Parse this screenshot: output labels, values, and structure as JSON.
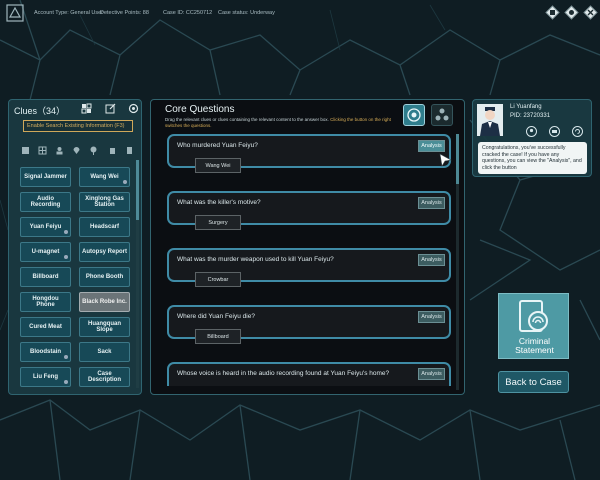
{
  "topbar": {
    "account": "Account Type: General User",
    "points": "Detective Points: 88",
    "case_id": "Case ID: CC250712",
    "status": "Case status: Underway"
  },
  "clues": {
    "title": "Clues（34）",
    "search_placeholder": "Enable Search Existing Information (F3)",
    "items": [
      {
        "label": "Signal Jammer"
      },
      {
        "label": "Wang Wei"
      },
      {
        "label": "Audio Recording"
      },
      {
        "label": "Xinglong Gas Station"
      },
      {
        "label": "Yuan Feiyu"
      },
      {
        "label": "Headscarf"
      },
      {
        "label": "U-magnet"
      },
      {
        "label": "Autopsy Report"
      },
      {
        "label": "Billboard"
      },
      {
        "label": "Phone Booth"
      },
      {
        "label": "Hongdou Phone"
      },
      {
        "label": "Black Robe Inc."
      },
      {
        "label": "Cured Meat"
      },
      {
        "label": "Huangquan Slope"
      },
      {
        "label": "Bloodstain"
      },
      {
        "label": "Sack"
      },
      {
        "label": "Liu Feng"
      },
      {
        "label": "Case Description"
      }
    ]
  },
  "core": {
    "title": "Core Questions",
    "instruction_a": "Drag the relevant clues or clues containing the relevant content to the answer box. ",
    "instruction_b": "Clicking the button on the right switches the questions.",
    "questions": [
      {
        "q": "Who murdered Yuan Feiyu?",
        "answer": "Wang Wei",
        "analysis": "Analysis"
      },
      {
        "q": "What was the killer's motive?",
        "answer": "Surgery",
        "analysis": "Analysis"
      },
      {
        "q": "What was the murder weapon used to kill Yuan Feiyu?",
        "answer": "Crowbar",
        "analysis": "Analysis"
      },
      {
        "q": "Where did Yuan Feiyu die?",
        "answer": "Billboard",
        "analysis": "Analysis"
      },
      {
        "q": "Whose voice is heard in the audio recording found at Yuan Feiyu's home?",
        "answer": "",
        "analysis": "Analysis"
      }
    ]
  },
  "character": {
    "name": "Li Yuanfang",
    "pid": "PID: 23720331",
    "message": "Congratulations, you've successfully cracked the case! If you have any questions, you can view the \"Analysis\", and click the button"
  },
  "buttons": {
    "criminal_statement": "Criminal Statement",
    "back": "Back to Case"
  },
  "colors": {
    "accent": "#4e9aa4",
    "highlight": "#d8ae58"
  }
}
